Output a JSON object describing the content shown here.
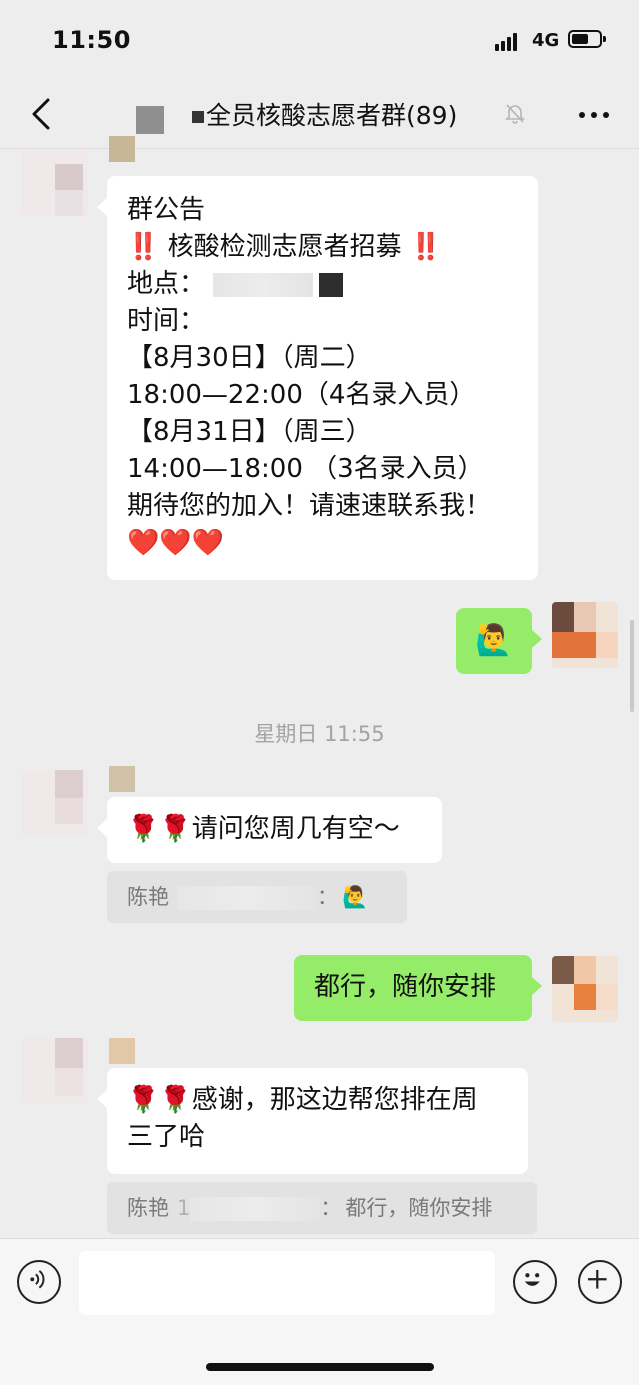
{
  "status_bar": {
    "time": "11:50",
    "network": "4G",
    "battery_level": 0.62
  },
  "header": {
    "title": "全员核酸志愿者群(89)"
  },
  "messages": {
    "announcement": {
      "lines": [
        "群公告",
        "‼️ 核酸检测志愿者招募 ‼️",
        "地点：",
        "时间：",
        "【8月30日】（周二）",
        "18:00—22:00（4名录入员）",
        "【8月31日】（周三）",
        "14:00—18:00 （3名录入员）",
        "期待您的加入！请速速联系我！",
        "❤️❤️❤️"
      ]
    },
    "sent_emoji": {
      "text": "🙋‍♂️"
    },
    "timestamp": "星期日 11:55",
    "ask": {
      "text": "🌹🌹请问您周几有空～"
    },
    "ask_quote": {
      "name": "陈艳",
      "sep": "：",
      "text": "🙋‍♂️"
    },
    "reply": {
      "text": "都行，随你安排"
    },
    "confirm": {
      "line1": "🌹🌹感谢，那这边帮您排在周",
      "line2": "三了哈"
    },
    "confirm_quote": {
      "name": "陈艳",
      "partial": "1",
      "sep": "：",
      "text": "都行，随你安排"
    }
  },
  "icons": {
    "back": "chevron-left-icon",
    "mute": "bell-off-icon",
    "more": "more-dots-icon",
    "voice": "voice-icon",
    "emoji": "emoji-icon",
    "add": "plus-icon"
  },
  "colors": {
    "background": "#ededed",
    "bubble_sent": "#95ec69",
    "bubble_received": "#ffffff"
  }
}
